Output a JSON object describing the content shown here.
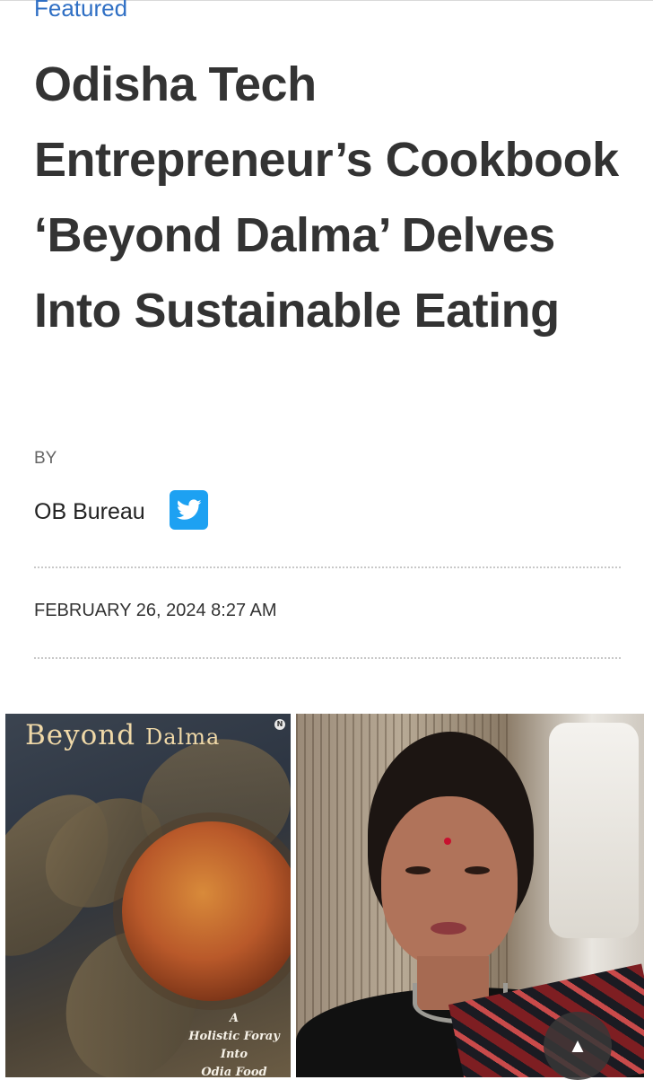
{
  "article": {
    "category": "Featured",
    "title": "Odisha Tech Entrepreneur’s Cookbook ‘Beyond Dalma’ Delves Into Sustainable Eating",
    "by_label": "BY",
    "author": "OB Bureau",
    "date": "FEBRUARY 26, 2024 8:27 AM"
  },
  "social": {
    "twitter_icon": "twitter-bird-icon",
    "twitter_color": "#1da1f2"
  },
  "image": {
    "cover_title_1": "Beyond",
    "cover_title_2": "Dalma",
    "publisher_mark": "N",
    "cover_subtitle_1": "A",
    "cover_subtitle_2": "Holistic Foray",
    "cover_subtitle_3": "Into",
    "cover_subtitle_4": "Odia Food"
  },
  "controls": {
    "scroll_top_glyph": "▲"
  },
  "colors": {
    "category_link": "#2f6fc4",
    "title": "#333333"
  }
}
